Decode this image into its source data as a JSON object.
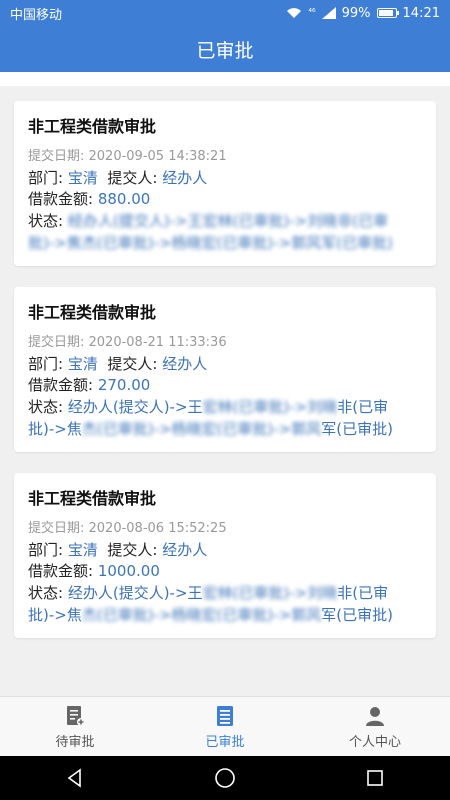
{
  "status_bar": {
    "carrier": "中国移动",
    "signal": "⁴⁶",
    "battery": "99%",
    "time": "14:21"
  },
  "header": {
    "title": "已审批"
  },
  "labels": {
    "date_prefix": "提交日期: ",
    "dept": "部门:",
    "submitter": "提交人:",
    "amount": "借款金额:",
    "status": "状态:"
  },
  "cards": [
    {
      "title": "非工程类借款审批",
      "date": "2020-09-05 14:38:21",
      "dept": "宝清",
      "submitter": "经办人",
      "amount": "880.00",
      "status_line1": "经办人(提交人)->王",
      "status_blur1": "宏林(已审批)->刘晓",
      "status_line1b": "非(已审",
      "status_line2a": "批)->焦",
      "status_blur2": "杰(已审批)->杨晓宏(已审批)->郭风",
      "status_line2b": "军(已审批)"
    },
    {
      "title": "非工程类借款审批",
      "date": "2020-08-21 11:33:36",
      "dept": "宝清",
      "submitter": "经办人",
      "amount": "270.00",
      "status_line1": "经办人(提交人)->王",
      "status_blur1": "宏林(已审批)->刘晓",
      "status_line1b": "非(已审",
      "status_line2a": "批)->焦",
      "status_blur2": "杰(已审批)->杨晓宏(已审批)->郭风",
      "status_line2b": "军(已审批)"
    },
    {
      "title": "非工程类借款审批",
      "date": "2020-08-06 15:52:25",
      "dept": "宝清",
      "submitter": "经办人",
      "amount": "1000.00",
      "status_line1": "经办人(提交人)->王",
      "status_blur1": "宏林(已审批)->刘晓",
      "status_line1b": "非(已审",
      "status_line2a": "批)->焦",
      "status_blur2": "杰(已审批)->杨晓宏(已审批)->郭风",
      "status_line2b": "军(已审批)"
    }
  ],
  "tabs": [
    {
      "label": "待审批",
      "icon": "document-add-icon"
    },
    {
      "label": "已审批",
      "icon": "list-document-icon"
    },
    {
      "label": "个人中心",
      "icon": "person-icon"
    }
  ],
  "colors": {
    "primary": "#3e7fd5",
    "link": "#3c74b8"
  }
}
